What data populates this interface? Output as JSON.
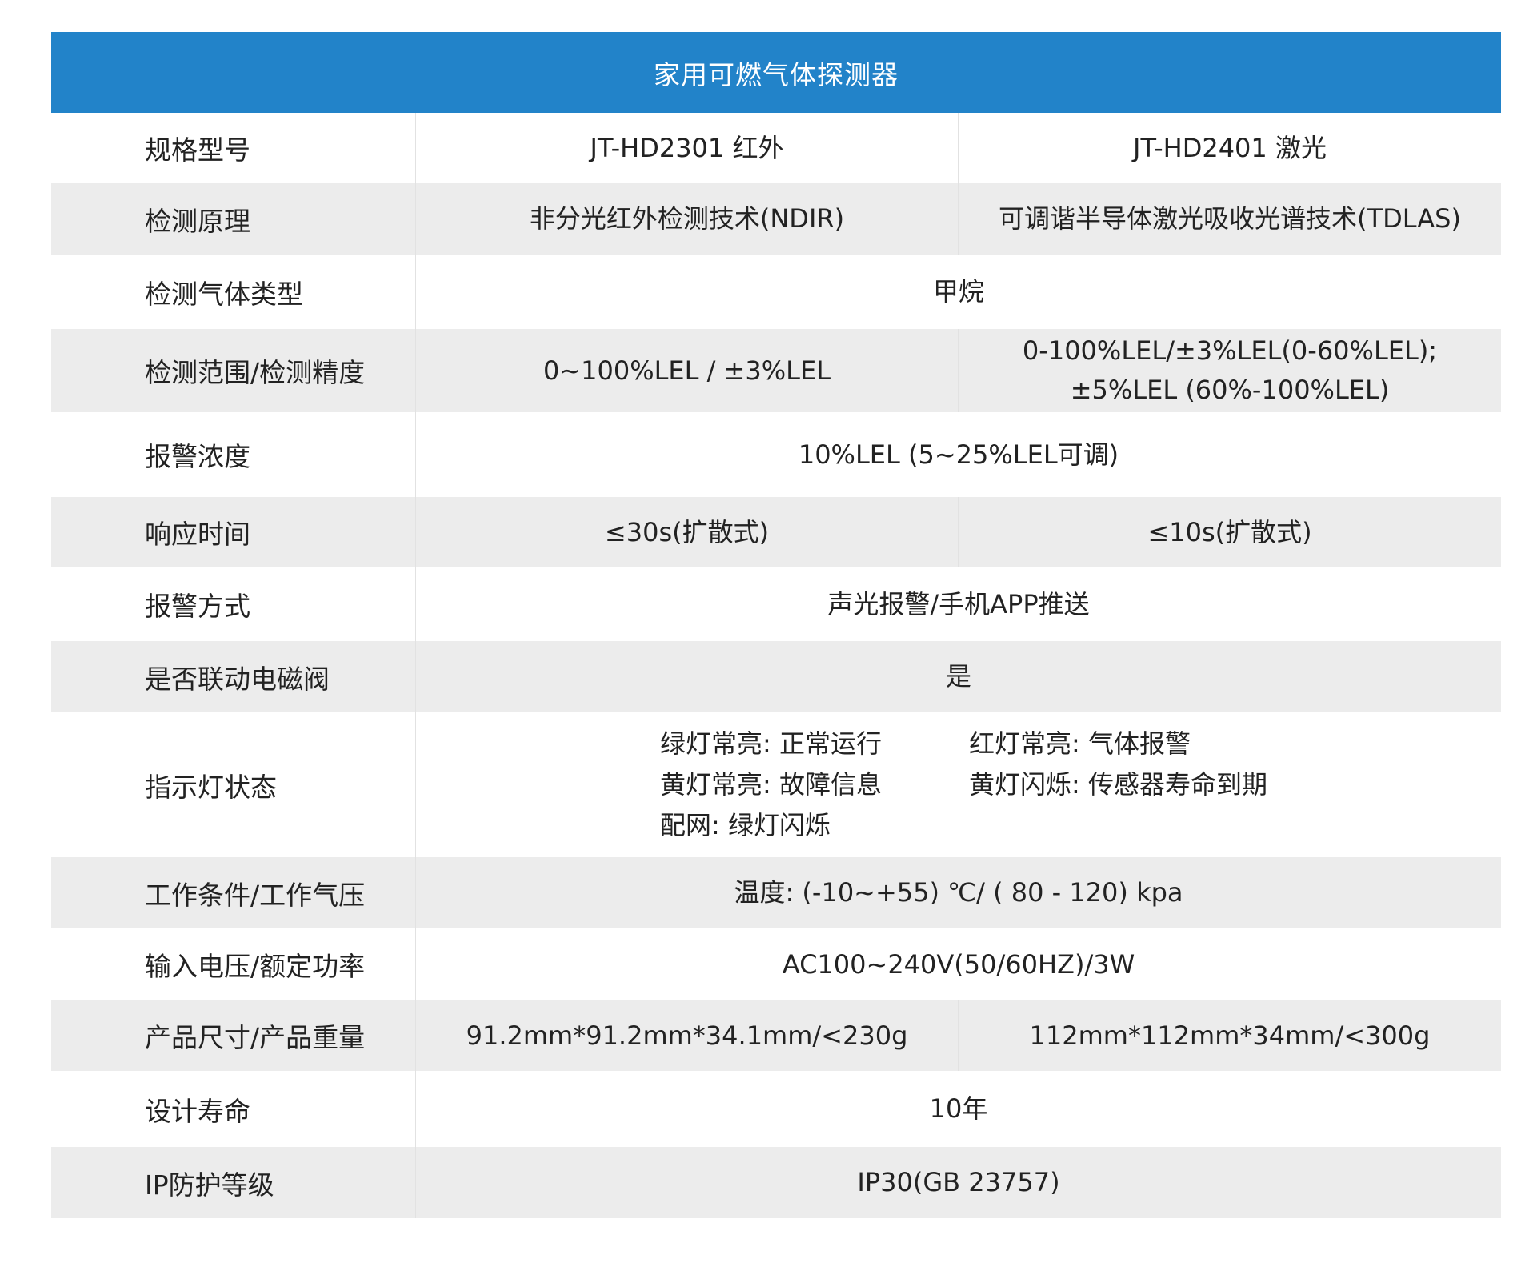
{
  "title": "家用可燃气体探测器",
  "rows": [
    {
      "label": "规格型号",
      "v1": "JT-HD2301 红外",
      "v2": "JT-HD2401 激光"
    },
    {
      "label": "检测原理",
      "v1": "非分光红外检测技术(NDIR)",
      "v2": "可调谐半导体激光吸收光谱技术(TDLAS)"
    },
    {
      "label": "检测气体类型",
      "span": "甲烷"
    },
    {
      "label": "检测范围/检测精度",
      "v1": "0~100%LEL / ±3%LEL",
      "v2_line1": "0-100%LEL/±3%LEL(0-60%LEL);",
      "v2_line2": "±5%LEL (60%-100%LEL)"
    },
    {
      "label": "报警浓度",
      "span": "10%LEL (5~25%LEL可调)"
    },
    {
      "label": "响应时间",
      "v1": "≤30s(扩散式)",
      "v2": "≤10s(扩散式)"
    },
    {
      "label": "报警方式",
      "span": "声光报警/手机APP推送"
    },
    {
      "label": "是否联动电磁阀",
      "span": "是"
    },
    {
      "label": "指示灯状态",
      "items": [
        "绿灯常亮: 正常运行",
        "红灯常亮: 气体报警",
        "黄灯常亮: 故障信息",
        "黄灯闪烁: 传感器寿命到期",
        "配网: 绿灯闪烁"
      ]
    },
    {
      "label": "工作条件/工作气压",
      "span": "温度: (-10~+55) ℃/ ( 80 - 120) kpa"
    },
    {
      "label": "输入电压/额定功率",
      "span": "AC100~240V(50/60HZ)/3W"
    },
    {
      "label": "产品尺寸/产品重量",
      "v1": "91.2mm*91.2mm*34.1mm/<230g",
      "v2": "112mm*112mm*34mm/<300g"
    },
    {
      "label": "设计寿命",
      "span": "10年"
    },
    {
      "label": "IP防护等级",
      "span": "IP30(GB 23757)"
    }
  ]
}
